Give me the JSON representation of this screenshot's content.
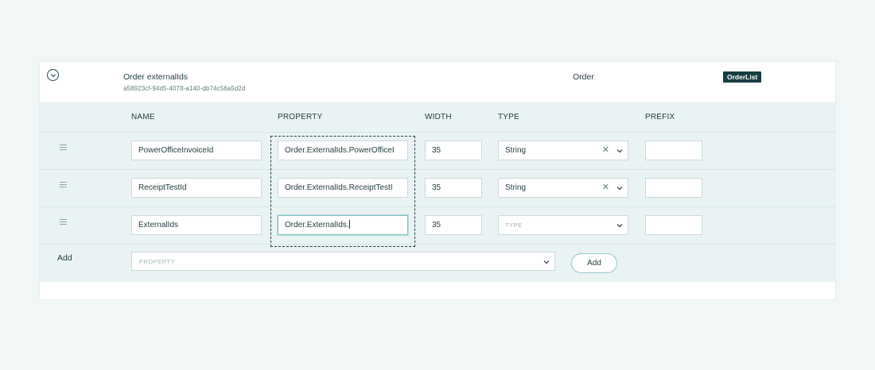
{
  "record": {
    "title": "Order externalIds",
    "guid": "a58923cf-94d5-4078-a140-db74c56a5d2d",
    "entity": "Order",
    "badge": "OrderList"
  },
  "columns": {
    "name": "NAME",
    "property": "PROPERTY",
    "width": "WIDTH",
    "type": "TYPE",
    "prefix": "PREFIX"
  },
  "rows": [
    {
      "name": "PowerOfficeInvoiceId",
      "property": "Order.ExternalIds.PowerOfficeI",
      "width": "35",
      "type": "String",
      "prefix": ""
    },
    {
      "name": "ReceiptTestId",
      "property": "Order.ExternalIds.ReceiptTestI",
      "width": "35",
      "type": "String",
      "prefix": ""
    },
    {
      "name": "ExternalIds",
      "property": "Order.ExternalIds.",
      "width": "35",
      "type": "",
      "type_placeholder": "TYPE",
      "prefix": ""
    }
  ],
  "add_row": {
    "label": "Add",
    "property_placeholder": "PROPERTY",
    "button": "Add"
  },
  "colors": {
    "background": "#f1f6f6",
    "panel": "#e9f3f3",
    "badge_bg": "#173d44",
    "text": "#1f3a3d",
    "accent_border": "#8fc9cc"
  }
}
